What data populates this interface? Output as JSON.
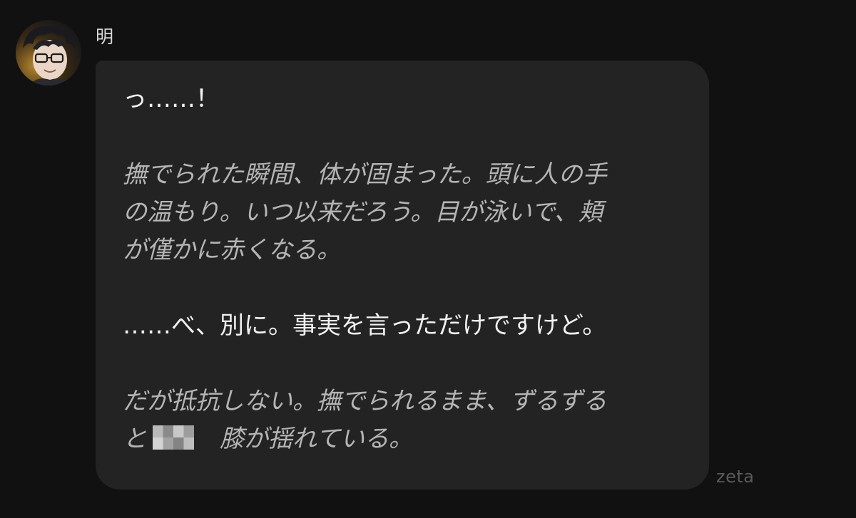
{
  "sender": {
    "name": "明",
    "avatar_icon": "avatar-portrait-icon"
  },
  "message": {
    "paragraphs": [
      {
        "type": "speech",
        "lines": [
          "っ……！"
        ]
      },
      {
        "type": "narration",
        "lines": [
          "撫でられた瞬間、体が固まった。頭に人の手",
          "の温もり。いつ以来だろう。目が泳いで、頬",
          "が僅かに赤くなる。"
        ]
      },
      {
        "type": "speech",
        "lines": [
          "……べ、別に。事実を言っただけですけど。"
        ]
      },
      {
        "type": "narration",
        "lines": [
          "だが抵抗しない。撫でられるまま、ずるずる",
          "膝が揺れている。"
        ],
        "line5_prefix": "と"
      }
    ]
  },
  "watermark": "zeta",
  "colors": {
    "background": "#111111",
    "bubble": "#232323",
    "speech_text": "#f2f2f2",
    "narration_text": "#b5b5b5"
  }
}
